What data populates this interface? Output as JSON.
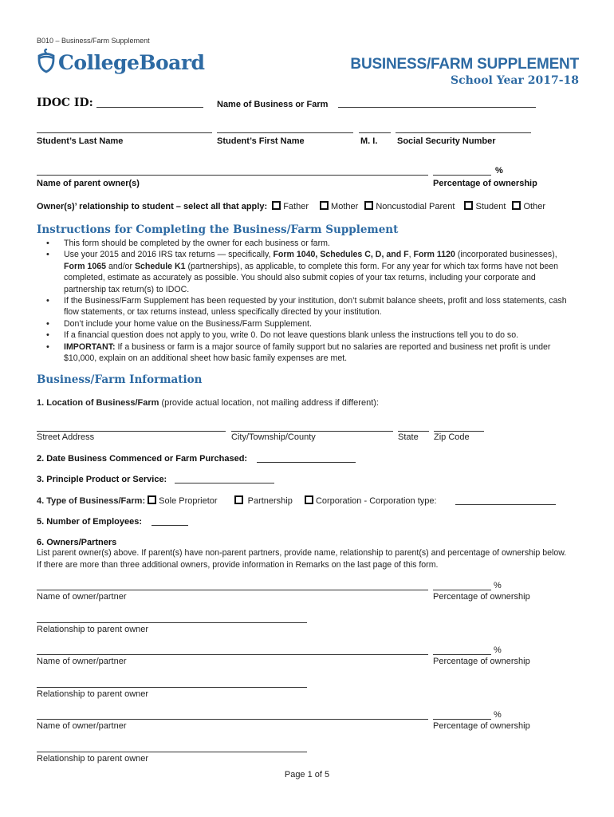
{
  "header": {
    "form_code": "B010 – Business/Farm Supplement",
    "logo_text": "CollegeBoard",
    "title": "BUSINESS/FARM SUPPLEMENT",
    "school_year": "School Year 2017-18"
  },
  "identity": {
    "idoc_label": "IDOC ID:",
    "idoc_value": "",
    "business_name_label": "Name of Business or Farm",
    "business_name_value": "",
    "last_name_label": "Student’s Last Name",
    "first_name_label": "Student’s First Name",
    "mi_label": "M. I.",
    "ssn_label": "Social Security Number",
    "parent_owner_label": "Name of parent owner(s)",
    "percent_sign": "%",
    "percent_label": "Percentage of ownership"
  },
  "relationship": {
    "label": "Owner(s)’ relationship to student – select all that apply:",
    "options": [
      {
        "label": "Father",
        "checked": false
      },
      {
        "label": "Mother",
        "checked": false
      },
      {
        "label": "Noncustodial Parent",
        "checked": false
      },
      {
        "label": "Student",
        "checked": false
      },
      {
        "label": "Other",
        "checked": false
      }
    ]
  },
  "instructions": {
    "heading": "Instructions for Completing the Business/Farm Supplement",
    "items": [
      {
        "parts": [
          {
            "t": "This form should be completed by the owner for each business or farm.",
            "b": false
          }
        ]
      },
      {
        "parts": [
          {
            "t": "Use your 2015 and 2016 IRS tax returns — specifically, ",
            "b": false
          },
          {
            "t": "Form 1040, Schedules C, D, and F",
            "b": true
          },
          {
            "t": ", ",
            "b": false
          },
          {
            "t": "Form 1120",
            "b": true
          },
          {
            "t": " (incorporated businesses), ",
            "b": false
          },
          {
            "t": "Form 1065",
            "b": true
          },
          {
            "t": " and/or ",
            "b": false
          },
          {
            "t": "Schedule K1",
            "b": true
          },
          {
            "t": " (partnerships), as applicable, to complete this form.  For any year for which tax forms have not been completed, estimate as accurately as possible.  You should also submit copies of your tax returns, including your corporate and partnership tax return(s) to IDOC.",
            "b": false
          }
        ]
      },
      {
        "parts": [
          {
            "t": "If the Business/Farm Supplement has been requested by your institution, don’t submit balance sheets, profit and loss statements, cash flow statements, or tax returns instead, unless specifically directed by your institution.",
            "b": false
          }
        ]
      },
      {
        "parts": [
          {
            "t": "Don’t include your home value on the Business/Farm Supplement.",
            "b": false
          }
        ]
      },
      {
        "parts": [
          {
            "t": "If a financial question does not apply to you, write 0. Do not leave questions blank unless the instructions tell you to do so.",
            "b": false
          }
        ]
      },
      {
        "parts": [
          {
            "t": "IMPORTANT:",
            "b": true
          },
          {
            "t": " If a business or farm is a major source of family support but no salaries are reported and business net profit is under $10,000, explain on an additional sheet how basic family expenses are met.",
            "b": false
          }
        ]
      }
    ]
  },
  "business_info": {
    "heading": "Business/Farm Information",
    "q1_label": "1.  Location of Business/Farm",
    "q1_note": " (provide actual location, not mailing address if different):",
    "street_label": "Street Address",
    "city_label": "City/Township/County",
    "state_label": "State",
    "zip_label": "Zip Code",
    "q2_label": "2.  Date Business Commenced or Farm Purchased:",
    "q3_label": "3.  Principle Product or Service:",
    "q4_label": "4.  Type of Business/Farm:",
    "q4_options": [
      {
        "label": "Sole Proprietor",
        "checked": false
      },
      {
        "label": "Partnership",
        "checked": false
      },
      {
        "label": "Corporation - Corporation type:",
        "checked": false
      }
    ],
    "q5_label": "5.  Number of Employees:",
    "q6_label": "6.  Owners/Partners",
    "q6_text": "List parent owner(s) above. If parent(s) have non-parent partners, provide name, relationship to parent(s) and percentage of ownership below. If there are more than three additional owners, provide information in Remarks on the last page of this form.",
    "owners": [
      {
        "name_label": "Name of owner/partner",
        "percent_sign": "%",
        "percent_label": "Percentage of ownership",
        "relationship_label": "Relationship to parent owner"
      },
      {
        "name_label": "Name of owner/partner",
        "percent_sign": "%",
        "percent_label": "Percentage of ownership",
        "relationship_label": "Relationship to parent owner"
      },
      {
        "name_label": "Name of owner/partner",
        "percent_sign": "%",
        "percent_label": "Percentage of ownership",
        "relationship_label": "Relationship to parent owner"
      }
    ]
  },
  "footer": {
    "page_label": "Page 1 of 5"
  },
  "colors": {
    "brand_blue": "#2d6aa3",
    "text": "#1a1a1a"
  }
}
